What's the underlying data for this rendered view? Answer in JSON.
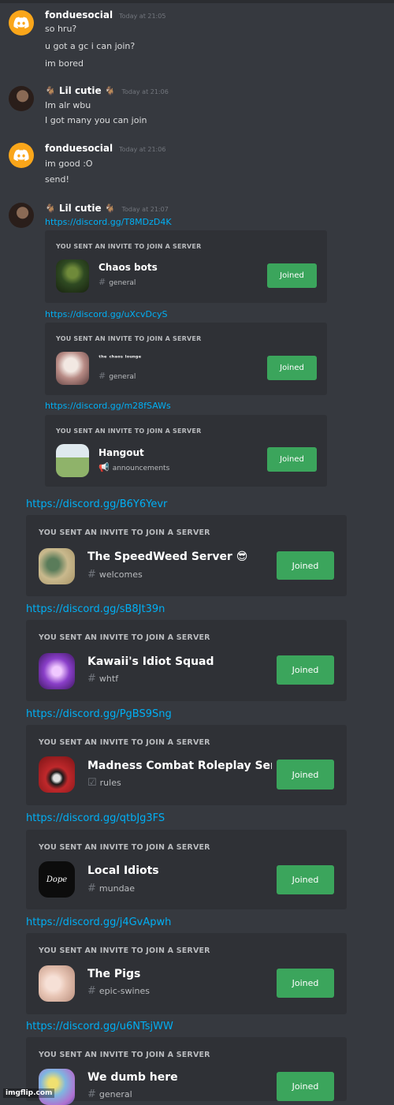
{
  "messages": [
    {
      "author": "fonduesocial",
      "time": "Today at 21:05",
      "lines": [
        "so hru?",
        "u got a gc i can join?",
        "im bored"
      ]
    },
    {
      "author": "Lil cutie",
      "author_emoji": "🐐",
      "time": "Today at 21:06",
      "lines": [
        "Im alr wbu",
        "I got many you can join"
      ]
    },
    {
      "author": "fonduesocial",
      "time": "Today at 21:06",
      "lines": [
        "im good :O",
        "send!"
      ]
    },
    {
      "author": "Lil cutie",
      "author_emoji": "🐐",
      "time": "Today at 21:07"
    }
  ],
  "invite_header": "YOU SENT AN INVITE TO JOIN A SERVER",
  "joined_label": "Joined",
  "invites": [
    {
      "link": "https://discord.gg/T8MDzD4K",
      "server": "Chaos bots",
      "channel": "general",
      "channel_icon": "hash-icon",
      "icon_color": "#2f4a22"
    },
    {
      "link": "https://discord.gg/uXcvDcyS",
      "server": "ᵗʰᵉ ᶜʰᵃᵒˢ ˡᵒᵘⁿᵍᵉ",
      "channel": "general",
      "channel_icon": "hash-icon",
      "icon_color": "#d8c7c0"
    },
    {
      "link": "https://discord.gg/m28fSAWs",
      "server": "Hangout",
      "channel": "announcements",
      "channel_icon": "megaphone-icon",
      "icon_color": "#7fa860"
    },
    {
      "link": "https://discord.gg/B6Y6Yevr",
      "server": "The SpeedWeed Server 😎",
      "channel": "welcomes",
      "channel_icon": "hash-icon",
      "icon_color": "#c9b98d"
    },
    {
      "link": "https://discord.gg/sB8Jt39n",
      "server": "Kawaii's Idiot Squad",
      "channel": "whtf",
      "channel_icon": "hash-icon",
      "icon_color": "#8a3fc9"
    },
    {
      "link": "https://discord.gg/PgBS9Sng",
      "server": "Madness Combat Roleplay Server",
      "channel": "rules",
      "channel_icon": "rules-icon",
      "icon_color": "#c0282b"
    },
    {
      "link": "https://discord.gg/qtbJg3FS",
      "server": "Local Idiots",
      "channel": "mundae",
      "channel_icon": "hash-icon",
      "icon_color": "#0c0c0c",
      "icon_text": "Dope"
    },
    {
      "link": "https://discord.gg/j4GvApwh",
      "server": "The Pigs",
      "channel": "epic-swines",
      "channel_icon": "hash-icon",
      "icon_color": "#e8c6b6"
    },
    {
      "link": "https://discord.gg/u6NTsjWW",
      "server": "We dumb here",
      "channel": "general",
      "channel_icon": "hash-icon",
      "icon_color": "#7fb7e0"
    }
  ],
  "watermark": "imgflip.com"
}
